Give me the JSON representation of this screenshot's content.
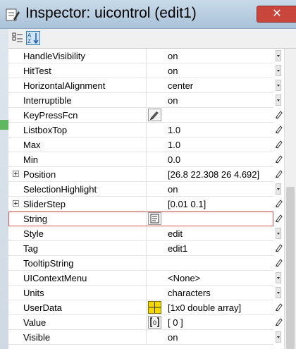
{
  "window": {
    "title": "Inspector:  uicontrol (edit1)",
    "close_label": "✕"
  },
  "toolbar": {
    "categorized_icon": "categorized-view-icon",
    "alphabetical_icon": "alphabetical-sort-icon"
  },
  "properties": [
    {
      "name": "HandleVisibility",
      "value": "on",
      "control": "dropdown"
    },
    {
      "name": "HitTest",
      "value": "on",
      "control": "dropdown"
    },
    {
      "name": "HorizontalAlignment",
      "value": "center",
      "control": "dropdown"
    },
    {
      "name": "Interruptible",
      "value": "on",
      "control": "dropdown"
    },
    {
      "name": "KeyPressFcn",
      "value": "",
      "control": "edit",
      "button_icon": "callback-editor-icon"
    },
    {
      "name": "ListboxTop",
      "value": "1.0",
      "control": "edit"
    },
    {
      "name": "Max",
      "value": "1.0",
      "control": "edit"
    },
    {
      "name": "Min",
      "value": "0.0",
      "control": "edit"
    },
    {
      "name": "Position",
      "value": "[26.8 22.308 26 4.692]",
      "control": "edit",
      "expandable": true
    },
    {
      "name": "SelectionHighlight",
      "value": "on",
      "control": "dropdown"
    },
    {
      "name": "SliderStep",
      "value": "[0.01 0.1]",
      "control": "edit",
      "expandable": true
    },
    {
      "name": "String",
      "value": "",
      "control": "edit",
      "button_icon": "text-editor-icon",
      "selected": true
    },
    {
      "name": "Style",
      "value": "edit",
      "control": "dropdown"
    },
    {
      "name": "Tag",
      "value": "edit1",
      "control": "edit"
    },
    {
      "name": "TooltipString",
      "value": "",
      "control": "edit"
    },
    {
      "name": "UIContextMenu",
      "value": "<None>",
      "control": "dropdown"
    },
    {
      "name": "Units",
      "value": "characters",
      "control": "dropdown"
    },
    {
      "name": "UserData",
      "value": "[1x0  double array]",
      "control": "edit",
      "button_icon": "array-editor-icon"
    },
    {
      "name": "Value",
      "value": "[ 0 ]",
      "control": "edit",
      "button_icon": "matrix-editor-icon"
    },
    {
      "name": "Visible",
      "value": "on",
      "control": "dropdown"
    }
  ]
}
